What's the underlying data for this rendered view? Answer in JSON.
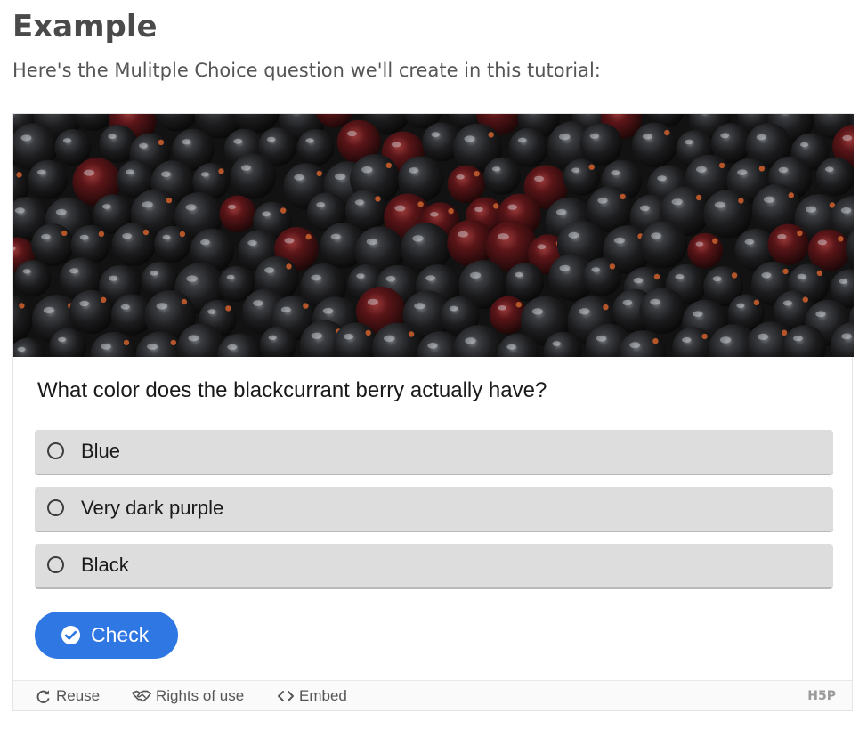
{
  "page": {
    "title": "Example",
    "intro": "Here's the Mulitple Choice question we'll create in this tutorial:"
  },
  "quiz": {
    "image_subject": "blackcurrant berries",
    "question": "What color does the blackcurrant berry actually have?",
    "answers": [
      {
        "label": "Blue",
        "selected": false
      },
      {
        "label": "Very dark purple",
        "selected": false
      },
      {
        "label": "Black",
        "selected": false
      }
    ],
    "check_label": "Check",
    "accent_color": "#2f77e3"
  },
  "footer": {
    "reuse_label": "Reuse",
    "rights_label": "Rights of use",
    "embed_label": "Embed",
    "logo_text": "H5P"
  }
}
